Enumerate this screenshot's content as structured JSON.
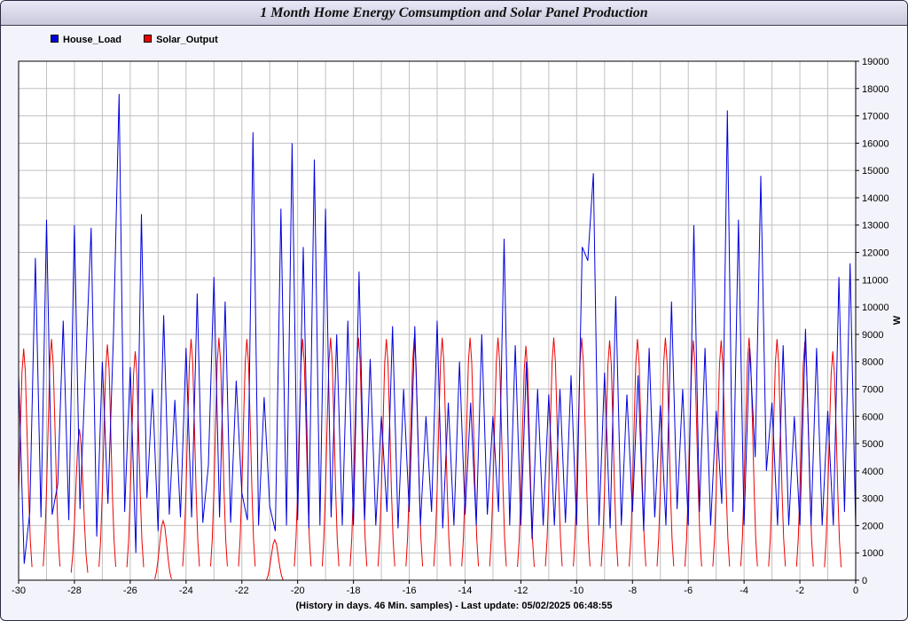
{
  "title": "1 Month Home Energy Comsumption and Solar Panel Production",
  "footer": "(History in days. 46 Min. samples) - Last update: 05/02/2025 06:48:55",
  "colors": {
    "house": "#0000dd",
    "solar": "#ee0000",
    "grid": "#c0c0c0",
    "frame": "#2a2a40"
  },
  "chart_data": {
    "type": "line",
    "title": "1 Month Home Energy Comsumption and Solar Panel Production",
    "xlabel": "(History in days. 46 Min. samples) - Last update: 05/02/2025 06:48:55",
    "ylabel": "W",
    "xlim": [
      -30,
      0
    ],
    "ylim": [
      0,
      19000
    ],
    "x_ticks": [
      -30,
      -28,
      -26,
      -24,
      -22,
      -20,
      -18,
      -16,
      -14,
      -12,
      -10,
      -8,
      -6,
      -4,
      -2,
      0
    ],
    "y_ticks": [
      0,
      1000,
      2000,
      3000,
      4000,
      5000,
      6000,
      7000,
      8000,
      9000,
      10000,
      11000,
      12000,
      13000,
      14000,
      15000,
      16000,
      17000,
      18000,
      19000
    ],
    "grid": true,
    "legend_position": "top-left",
    "series": [
      {
        "name": "House_Load",
        "color": "#0000dd",
        "x": [
          -30.0,
          -29.8,
          -29.6,
          -29.4,
          -29.2,
          -29.0,
          -28.8,
          -28.6,
          -28.4,
          -28.2,
          -28.0,
          -27.8,
          -27.6,
          -27.4,
          -27.2,
          -27.0,
          -26.8,
          -26.6,
          -26.4,
          -26.2,
          -26.0,
          -25.8,
          -25.6,
          -25.4,
          -25.2,
          -25.0,
          -24.8,
          -24.6,
          -24.4,
          -24.2,
          -24.0,
          -23.8,
          -23.6,
          -23.4,
          -23.2,
          -23.0,
          -22.8,
          -22.6,
          -22.4,
          -22.2,
          -22.0,
          -21.8,
          -21.6,
          -21.4,
          -21.2,
          -21.0,
          -20.8,
          -20.6,
          -20.4,
          -20.2,
          -20.0,
          -19.8,
          -19.6,
          -19.4,
          -19.2,
          -19.0,
          -18.8,
          -18.6,
          -18.4,
          -18.2,
          -18.0,
          -17.8,
          -17.6,
          -17.4,
          -17.2,
          -17.0,
          -16.8,
          -16.6,
          -16.4,
          -16.2,
          -16.0,
          -15.8,
          -15.6,
          -15.4,
          -15.2,
          -15.0,
          -14.8,
          -14.6,
          -14.4,
          -14.2,
          -14.0,
          -13.8,
          -13.6,
          -13.4,
          -13.2,
          -13.0,
          -12.8,
          -12.6,
          -12.4,
          -12.2,
          -12.0,
          -11.8,
          -11.6,
          -11.4,
          -11.2,
          -11.0,
          -10.8,
          -10.6,
          -10.4,
          -10.2,
          -10.0,
          -9.8,
          -9.6,
          -9.4,
          -9.2,
          -9.0,
          -8.8,
          -8.6,
          -8.4,
          -8.2,
          -8.0,
          -7.8,
          -7.6,
          -7.4,
          -7.2,
          -7.0,
          -6.8,
          -6.6,
          -6.4,
          -6.2,
          -6.0,
          -5.8,
          -5.6,
          -5.4,
          -5.2,
          -5.0,
          -4.8,
          -4.6,
          -4.4,
          -4.2,
          -4.0,
          -3.8,
          -3.6,
          -3.4,
          -3.2,
          -3.0,
          -2.8,
          -2.6,
          -2.4,
          -2.2,
          -2.0,
          -1.8,
          -1.6,
          -1.4,
          -1.2,
          -1.0,
          -0.8,
          -0.6,
          -0.4,
          -0.2,
          0.0
        ],
        "values": [
          7500,
          600,
          2500,
          11800,
          2300,
          13200,
          2400,
          3500,
          9500,
          2200,
          13000,
          2600,
          7800,
          12900,
          1600,
          8000,
          2800,
          9000,
          17800,
          2500,
          7800,
          1000,
          13400,
          3000,
          7000,
          1800,
          9700,
          2400,
          6600,
          2300,
          8500,
          2300,
          10500,
          2100,
          4200,
          11100,
          2300,
          10200,
          2100,
          7300,
          3200,
          2200,
          16400,
          2000,
          6700,
          2700,
          1800,
          13600,
          2000,
          16000,
          2200,
          12200,
          1900,
          15400,
          2000,
          13600,
          2300,
          9000,
          2000,
          9500,
          2000,
          11300,
          2200,
          8100,
          2000,
          6000,
          2500,
          9300,
          1900,
          7000,
          2500,
          9300,
          2000,
          6000,
          2500,
          9500,
          1900,
          6500,
          2000,
          8000,
          2400,
          6500,
          2000,
          9000,
          2400,
          6000,
          2500,
          12500,
          2000,
          8600,
          2000,
          8000,
          1500,
          7000,
          2000,
          6800,
          2000,
          7000,
          2100,
          7500,
          2000,
          12200,
          11700,
          14900,
          2000,
          7600,
          1900,
          10400,
          2000,
          6800,
          2500,
          7500,
          1800,
          8500,
          2300,
          6400,
          2000,
          10200,
          2600,
          7000,
          2000,
          13000,
          2500,
          8500,
          2000,
          6200,
          2800,
          17200,
          2500,
          13200,
          2000,
          8500,
          4500,
          14800,
          4000,
          6500,
          2000,
          8600,
          2000,
          6000,
          2000,
          9200,
          2000,
          8500,
          2000,
          6200,
          2000,
          11100,
          2500,
          11600,
          1900
        ]
      },
      {
        "name": "Solar_Output",
        "color": "#ee0000",
        "x": [
          -29.82,
          -28.82,
          -27.82,
          -26.82,
          -25.82,
          -24.82,
          -23.82,
          -22.82,
          -21.82,
          -20.82,
          -19.82,
          -18.82,
          -17.82,
          -16.82,
          -15.82,
          -14.82,
          -13.82,
          -12.82,
          -11.82,
          -10.82,
          -9.82,
          -8.82,
          -7.82,
          -6.82,
          -5.82,
          -4.82,
          -3.82,
          -2.82,
          -1.82,
          -0.82
        ],
        "values": [
          8600,
          8950,
          5650,
          8750,
          8500,
          2300,
          8950,
          9000,
          8950,
          1600,
          8950,
          9000,
          9000,
          8950,
          9000,
          9000,
          9000,
          9000,
          8700,
          9000,
          9000,
          8900,
          8950,
          9000,
          8900,
          8900,
          9000,
          8950,
          8850,
          8500
        ]
      }
    ]
  }
}
